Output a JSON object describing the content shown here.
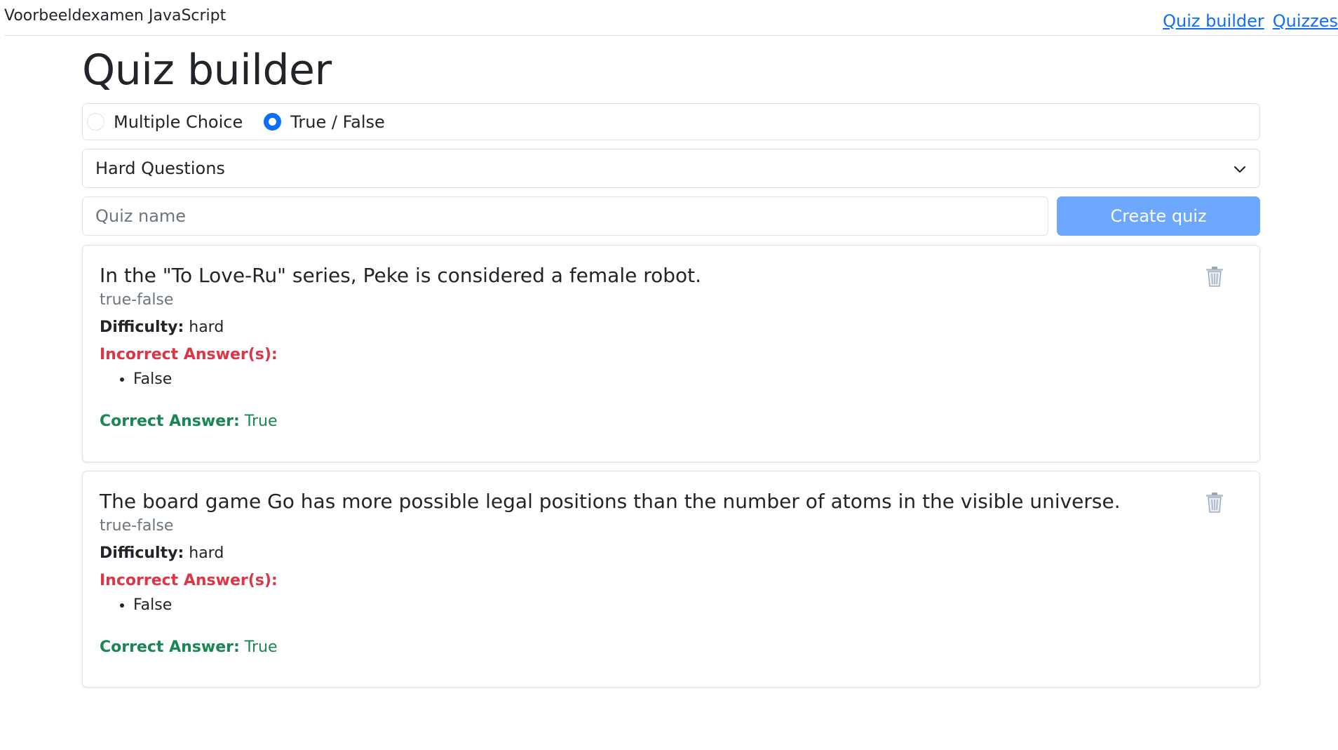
{
  "header": {
    "brand": "Voorbeeldexamen JavaScript",
    "nav": [
      "Quiz builder",
      "Quizzes"
    ]
  },
  "page_title": "Quiz builder",
  "question_type": {
    "options": [
      "Multiple Choice",
      "True / False"
    ],
    "selected": "True / False"
  },
  "difficulty_select": {
    "value": "Hard Questions"
  },
  "quiz_form": {
    "name_placeholder": "Quiz name",
    "name_value": "",
    "create_label": "Create quiz"
  },
  "labels": {
    "difficulty": "Difficulty:",
    "incorrect": "Incorrect Answer(s):",
    "correct": "Correct Answer:"
  },
  "questions": [
    {
      "text": "In the \"To Love-Ru\" series, Peke is considered a female robot.",
      "type": "true-false",
      "difficulty": "hard",
      "incorrect_answers": [
        "False"
      ],
      "correct_answer": "True"
    },
    {
      "text": "The board game Go has more possible legal positions than the number of atoms in the visible universe.",
      "type": "true-false",
      "difficulty": "hard",
      "incorrect_answers": [
        "False"
      ],
      "correct_answer": "True"
    }
  ],
  "icons": {
    "delete": "trash-icon",
    "select": "chevron-down-icon"
  },
  "colors": {
    "primary": "#0d6efd",
    "button_disabled": "#6ea8fe",
    "incorrect": "#dc3545",
    "correct": "#198754"
  }
}
